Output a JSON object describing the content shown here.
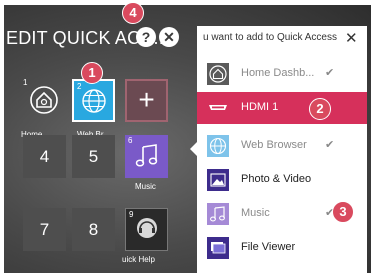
{
  "title": "EDIT QUICK ACC...",
  "help_symbol": "?",
  "close_symbol": "✕",
  "tiles": [
    {
      "num": "1",
      "label": "Home ...",
      "icon": "home-icon"
    },
    {
      "num": "2",
      "label": "Web Br...",
      "icon": "globe-icon"
    },
    {
      "num": "",
      "label": "",
      "icon": "plus-icon",
      "text": "+"
    },
    {
      "text": "4"
    },
    {
      "text": "5"
    },
    {
      "num": "6",
      "label": "Music",
      "icon": "music-note-icon"
    },
    {
      "text": "7"
    },
    {
      "text": "8"
    },
    {
      "num": "9",
      "label": "uick Help",
      "icon": "headset-icon"
    }
  ],
  "panel": {
    "header": "u want to add to Quick Access",
    "close_symbol": "✕",
    "items": [
      {
        "label": "Home Dashb...",
        "added": true,
        "icon": "home-icon"
      },
      {
        "label": "HDMI 1",
        "added": false,
        "selected": true,
        "icon": "hdmi-icon"
      },
      {
        "label": "Web Browser",
        "added": true,
        "icon": "globe-icon"
      },
      {
        "label": "Photo & Video",
        "added": false,
        "icon": "photo-icon"
      },
      {
        "label": "Music",
        "added": true,
        "icon": "music-note-icon"
      },
      {
        "label": "File Viewer",
        "added": false,
        "icon": "file-viewer-icon"
      }
    ],
    "check_symbol": "✔"
  },
  "callouts": [
    "1",
    "2",
    "3",
    "4"
  ],
  "colors": {
    "accent": "#d6305b",
    "callout": "#d94a5e",
    "tile_blue": "#29a8e0",
    "tile_purple": "#7a5ac8",
    "tile_dark": "#4e4e4e"
  }
}
